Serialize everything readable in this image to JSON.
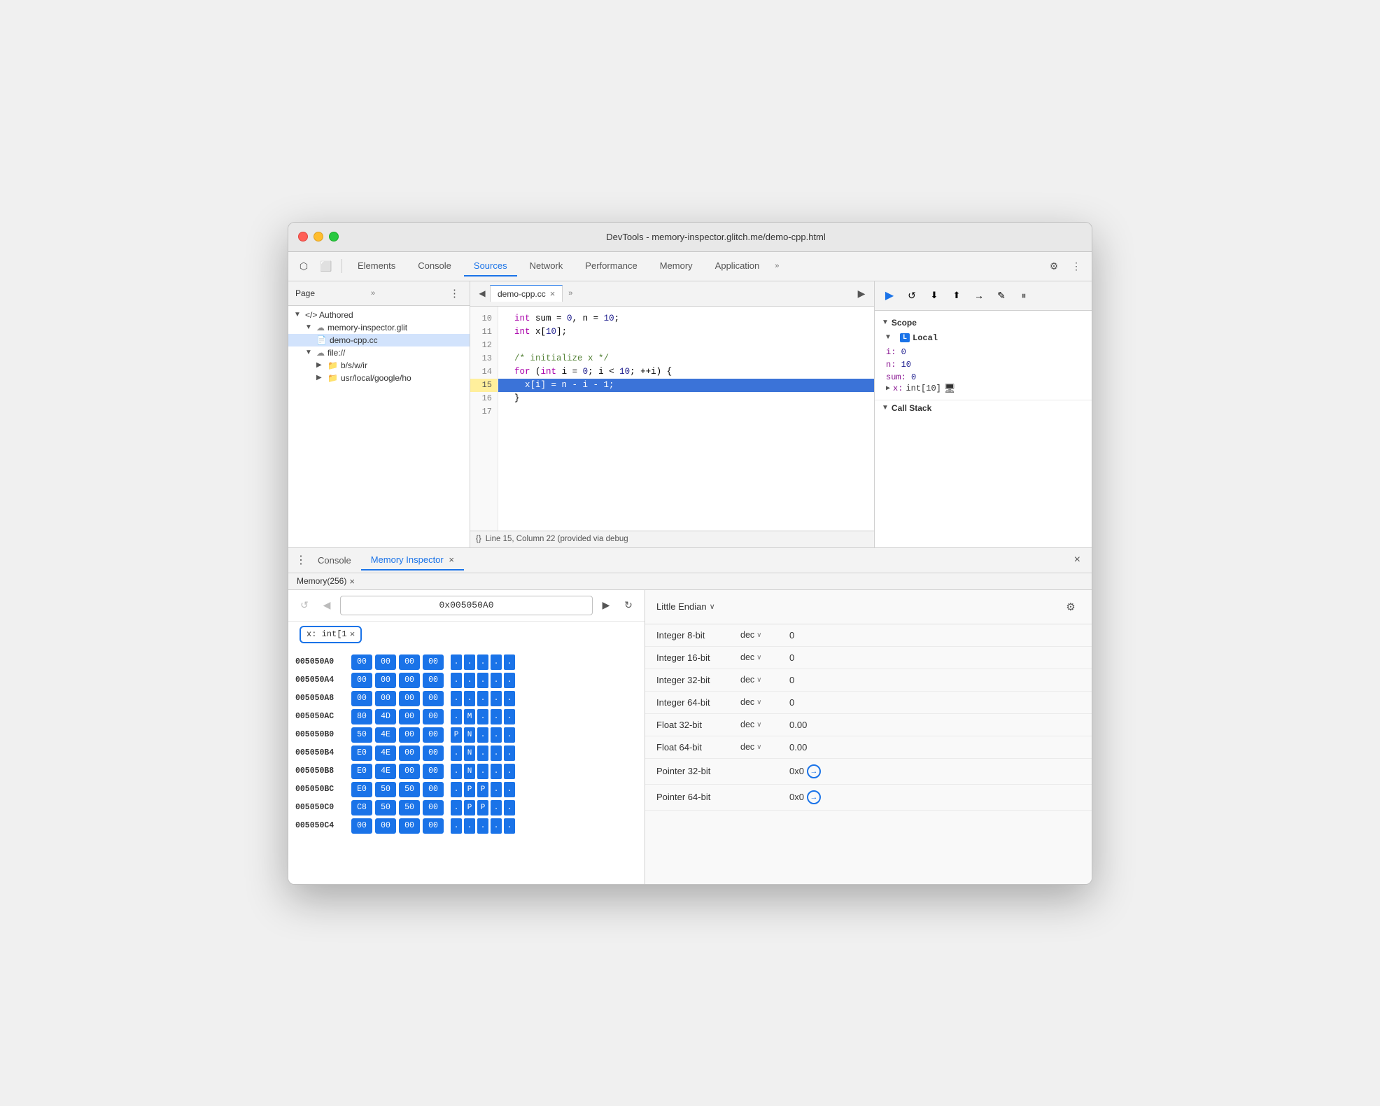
{
  "window": {
    "title": "DevTools - memory-inspector.glitch.me/demo-cpp.html"
  },
  "toolbar": {
    "tabs": [
      "Elements",
      "Console",
      "Sources",
      "Network",
      "Performance",
      "Memory",
      "Application"
    ],
    "active_tab": "Sources",
    "more_tabs": "»",
    "settings_icon": "⚙",
    "dots_icon": "⋮"
  },
  "sidebar": {
    "header": "Page",
    "more": "»",
    "dots": "⋮",
    "tree": [
      {
        "label": "</> Authored",
        "indent": 0,
        "type": "authored"
      },
      {
        "label": "memory-inspector.glit",
        "indent": 1,
        "type": "cloud"
      },
      {
        "label": "demo-cpp.cc",
        "indent": 2,
        "type": "file",
        "selected": true
      },
      {
        "label": "file://",
        "indent": 1,
        "type": "cloud"
      },
      {
        "label": "b/s/w/ir",
        "indent": 2,
        "type": "folder"
      },
      {
        "label": "usr/local/google/ho",
        "indent": 2,
        "type": "folder"
      }
    ]
  },
  "source": {
    "file_name": "demo-cpp.cc",
    "close_icon": "×",
    "more_tabs": "»",
    "run_btn": "▶",
    "lines": [
      {
        "num": 10,
        "content": "  int sum = 0, n = 10;",
        "highlighted": false
      },
      {
        "num": 11,
        "content": "  int x[10];",
        "highlighted": false
      },
      {
        "num": 12,
        "content": "",
        "highlighted": false
      },
      {
        "num": 13,
        "content": "  /* initialize x */",
        "highlighted": false
      },
      {
        "num": 14,
        "content": "  for (int i = 0; i < 10; ++i) {",
        "highlighted": false
      },
      {
        "num": 15,
        "content": "    x[i] = n - i - 1;",
        "highlighted": true
      },
      {
        "num": 16,
        "content": "  }",
        "highlighted": false
      },
      {
        "num": 17,
        "content": "",
        "highlighted": false
      }
    ],
    "status": "Line 15, Column 22 (provided via debug"
  },
  "debug": {
    "buttons": [
      "▶",
      "↺",
      "↓",
      "↑",
      "→",
      "✎",
      "⏸"
    ],
    "scope_label": "Scope",
    "scope_arrow": "▼",
    "local_label": "Local",
    "local_badge": "L",
    "vars": [
      {
        "name": "i:",
        "value": "0"
      },
      {
        "name": "n:",
        "value": "10"
      },
      {
        "name": "sum:",
        "value": "0"
      }
    ],
    "x_var": "▶ x: int[10]",
    "memory_icon": "🖥",
    "call_stack_label": "Call Stack",
    "call_stack_arrow": "▼"
  },
  "bottom": {
    "dots": "⋮",
    "tabs": [
      {
        "label": "Console",
        "active": false
      },
      {
        "label": "Memory Inspector",
        "active": true,
        "closable": true
      }
    ],
    "close": "×"
  },
  "memory_subtab": {
    "label": "Memory(256)",
    "close": "×"
  },
  "hex": {
    "back_btn": "↺",
    "prev_btn": "◀",
    "next_btn": "▶",
    "address": "0x005050A0",
    "refresh_btn": "↻",
    "var_tag": "x: int[1",
    "var_tag_close": "×",
    "rows": [
      {
        "addr": "005050A0",
        "bytes": [
          "00",
          "00",
          "00",
          "00"
        ],
        "ascii": [
          ".",
          ".",
          ".",
          ".",
          "."
        ],
        "selected": true
      },
      {
        "addr": "005050A4",
        "bytes": [
          "00",
          "00",
          "00",
          "00"
        ],
        "ascii": [
          ".",
          ".",
          ".",
          ".",
          "."
        ],
        "selected": true
      },
      {
        "addr": "005050A8",
        "bytes": [
          "00",
          "00",
          "00",
          "00"
        ],
        "ascii": [
          ".",
          ".",
          ".",
          ".",
          "."
        ],
        "selected": true
      },
      {
        "addr": "005050AC",
        "bytes": [
          "80",
          "4D",
          "00",
          "00"
        ],
        "ascii": [
          ".",
          "M",
          ".",
          ".",
          ".",
          "."
        ],
        "selected": true
      },
      {
        "addr": "005050B0",
        "bytes": [
          "50",
          "4E",
          "00",
          "00"
        ],
        "ascii": [
          "P",
          "N",
          ".",
          ".",
          ".",
          "."
        ],
        "selected": true
      },
      {
        "addr": "005050B4",
        "bytes": [
          "E0",
          "4E",
          "00",
          "00"
        ],
        "ascii": [
          ".",
          "N",
          ".",
          ".",
          ".",
          "."
        ],
        "selected": true
      },
      {
        "addr": "005050B8",
        "bytes": [
          "E0",
          "4E",
          "00",
          "00"
        ],
        "ascii": [
          ".",
          "N",
          ".",
          ".",
          ".",
          "."
        ],
        "selected": true
      },
      {
        "addr": "005050BC",
        "bytes": [
          "E0",
          "50",
          "50",
          "00"
        ],
        "ascii": [
          ".",
          "P",
          "P",
          ".",
          ".",
          "."
        ],
        "selected": true
      },
      {
        "addr": "005050C0",
        "bytes": [
          "C8",
          "50",
          "50",
          "00"
        ],
        "ascii": [
          ".",
          "P",
          "P",
          ".",
          ".",
          "."
        ],
        "selected": true
      },
      {
        "addr": "005050C4",
        "bytes": [
          "00",
          "00",
          "00",
          "00"
        ],
        "ascii": [
          ".",
          ".",
          ".",
          ".",
          "."
        ],
        "selected": true
      }
    ]
  },
  "interpretation": {
    "endian": "Little Endian",
    "endian_chevron": "∨",
    "settings_icon": "⚙",
    "rows": [
      {
        "type": "Integer 8-bit",
        "format": "dec",
        "value": "0",
        "link": null
      },
      {
        "type": "Integer 16-bit",
        "format": "dec",
        "value": "0",
        "link": null
      },
      {
        "type": "Integer 32-bit",
        "format": "dec",
        "value": "0",
        "link": null
      },
      {
        "type": "Integer 64-bit",
        "format": "dec",
        "value": "0",
        "link": null
      },
      {
        "type": "Float 32-bit",
        "format": "dec",
        "value": "0.00",
        "link": null
      },
      {
        "type": "Float 64-bit",
        "format": "dec",
        "value": "0.00",
        "link": null
      },
      {
        "type": "Pointer 32-bit",
        "format": null,
        "value": "0x0",
        "link": "→"
      },
      {
        "type": "Pointer 64-bit",
        "format": null,
        "value": "0x0",
        "link": "→"
      }
    ]
  }
}
